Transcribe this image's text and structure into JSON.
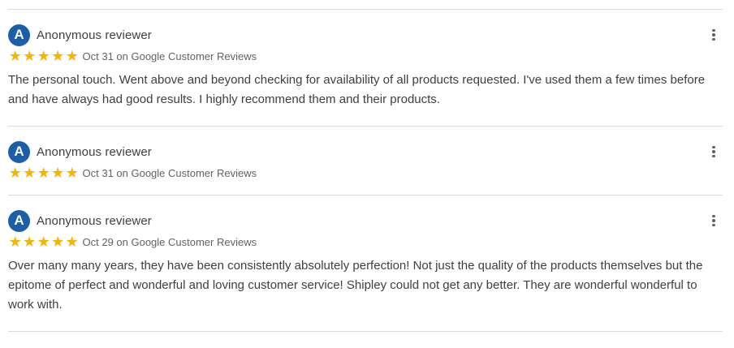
{
  "reviews": [
    {
      "avatar_letter": "A",
      "author": "Anonymous reviewer",
      "rating": 5,
      "meta": "Oct 31 on Google Customer Reviews",
      "text": "The personal touch. Went above and beyond checking for availability of all products requested. I've used them a few times before and have always had good results. I highly recommend them and their products."
    },
    {
      "avatar_letter": "A",
      "author": "Anonymous reviewer",
      "rating": 5,
      "meta": "Oct 31 on Google Customer Reviews",
      "text": ""
    },
    {
      "avatar_letter": "A",
      "author": "Anonymous reviewer",
      "rating": 5,
      "meta": "Oct 29 on Google Customer Reviews",
      "text": "Over many many years, they have been consistently absolutely perfection! Not just the quality of the products themselves but the epitome of perfect and wonderful and loving customer service! Shipley could not get any better. They are wonderful wonderful to work with."
    }
  ],
  "icons": {
    "star": "★",
    "star_color": "#f4b400",
    "avatar_color": "#1a5fa7",
    "menu": "more-vert-icon"
  }
}
